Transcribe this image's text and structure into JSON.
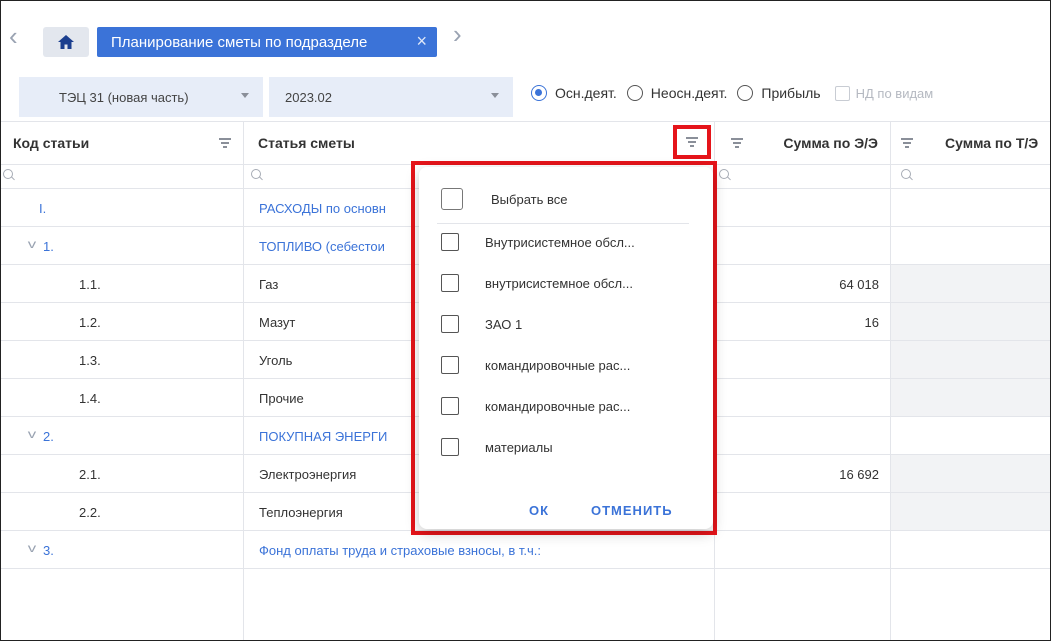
{
  "tabbar": {
    "active_tab": "Планирование сметы по подразделе",
    "close_glyph": "×"
  },
  "filters": {
    "unit_value": "ТЭЦ 31 (новая часть)",
    "period_value": "2023.02",
    "radios": [
      {
        "label": "Осн.деят.",
        "selected": true
      },
      {
        "label": "Неосн.деят.",
        "selected": false
      },
      {
        "label": "Прибыль",
        "selected": false
      }
    ],
    "nd_checkbox_label": "НД по видам"
  },
  "columns": {
    "code": "Код статьи",
    "article": "Статья сметы",
    "sum_ee": "Сумма по Э/Э",
    "sum_te": "Сумма по Т/Э"
  },
  "rows": [
    {
      "code": "I.",
      "name": "РАСХОДЫ по основн",
      "group": true,
      "value": ""
    },
    {
      "code": "1.",
      "name": "ТОПЛИВО (себестои",
      "group": true,
      "value": ""
    },
    {
      "code": "1.1.",
      "name": "Газ",
      "group": false,
      "value": "64 018"
    },
    {
      "code": "1.2.",
      "name": "Мазут",
      "group": false,
      "value": "16"
    },
    {
      "code": "1.3.",
      "name": "Уголь",
      "group": false,
      "value": ""
    },
    {
      "code": "1.4.",
      "name": "Прочие",
      "group": false,
      "value": ""
    },
    {
      "code": "2.",
      "name": "ПОКУПНАЯ ЭНЕРГИ",
      "group": true,
      "value": ""
    },
    {
      "code": "2.1.",
      "name": "Электроэнергия",
      "group": false,
      "value": "16 692"
    },
    {
      "code": "2.2.",
      "name": "Теплоэнергия",
      "group": false,
      "value": ""
    },
    {
      "code": "3.",
      "name": "Фонд оплаты труда и страховые взносы, в т.ч.:",
      "group": true,
      "value": ""
    }
  ],
  "popup": {
    "select_all": "Выбрать все",
    "items": [
      "Внутрисистемное обсл...",
      "внутрисистемное обсл...",
      "ЗАО 1",
      "командировочные рас...",
      "командировочные рас...",
      "материалы"
    ],
    "ok": "ОК",
    "cancel": "ОТМЕНИТЬ"
  },
  "colors": {
    "accent": "#3b73d8",
    "highlight": "#e5141a"
  }
}
